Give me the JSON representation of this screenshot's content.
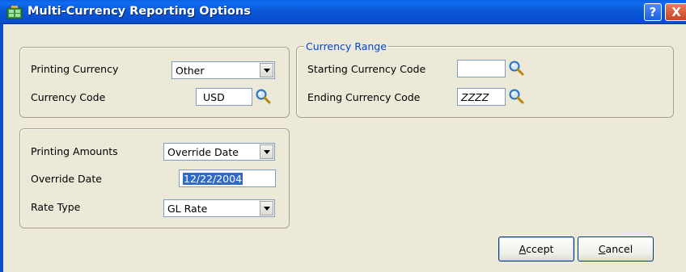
{
  "window": {
    "title": "Multi-Currency Reporting Options",
    "help_label": "?",
    "close_label": "X"
  },
  "printing_group": {
    "printing_currency": {
      "label": "Printing Currency",
      "value": "Other"
    },
    "currency_code": {
      "label": "Currency Code",
      "value": "USD"
    }
  },
  "currency_range": {
    "legend": "Currency Range",
    "starting": {
      "label": "Starting Currency Code",
      "value": ""
    },
    "ending": {
      "label": "Ending Currency Code",
      "value": "ZZZZ"
    }
  },
  "amounts_group": {
    "printing_amounts": {
      "label": "Printing Amounts",
      "value": "Override Date"
    },
    "override_date": {
      "label": "Override Date",
      "value": "12/22/2004"
    },
    "rate_type": {
      "label": "Rate Type",
      "value": "GL Rate"
    }
  },
  "buttons": {
    "accept": {
      "mnemonic": "A",
      "rest": "ccept"
    },
    "cancel": {
      "mnemonic": "C",
      "rest": "ancel"
    }
  },
  "colors": {
    "titlebar": "#0a58d6",
    "legend": "#0046d5",
    "selection": "#316ac5",
    "dialog_bg": "#ece9d8"
  }
}
